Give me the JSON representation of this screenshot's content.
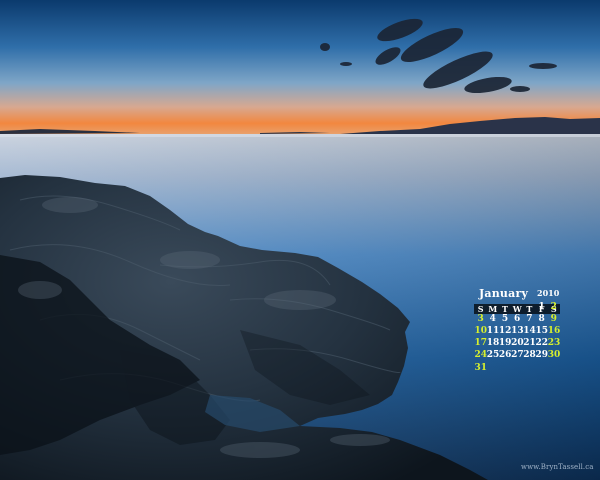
{
  "calendar": {
    "month": "January",
    "year": "2010",
    "weekdays": [
      "S",
      "M",
      "T",
      "W",
      "T",
      "F",
      "S"
    ],
    "first_weekday_index": 5,
    "days_in_month": 31,
    "weekend_color": "#d6ef2e",
    "weekday_color": "#ffffff"
  },
  "watermark": "www.BrynTassell.ca",
  "colors": {
    "sky_top": "#0b3a6d",
    "sky_mid": "#3a7fb8",
    "horizon_glow": "#f2873f",
    "sea": "#1d5d98",
    "rock": "#1c2630"
  }
}
